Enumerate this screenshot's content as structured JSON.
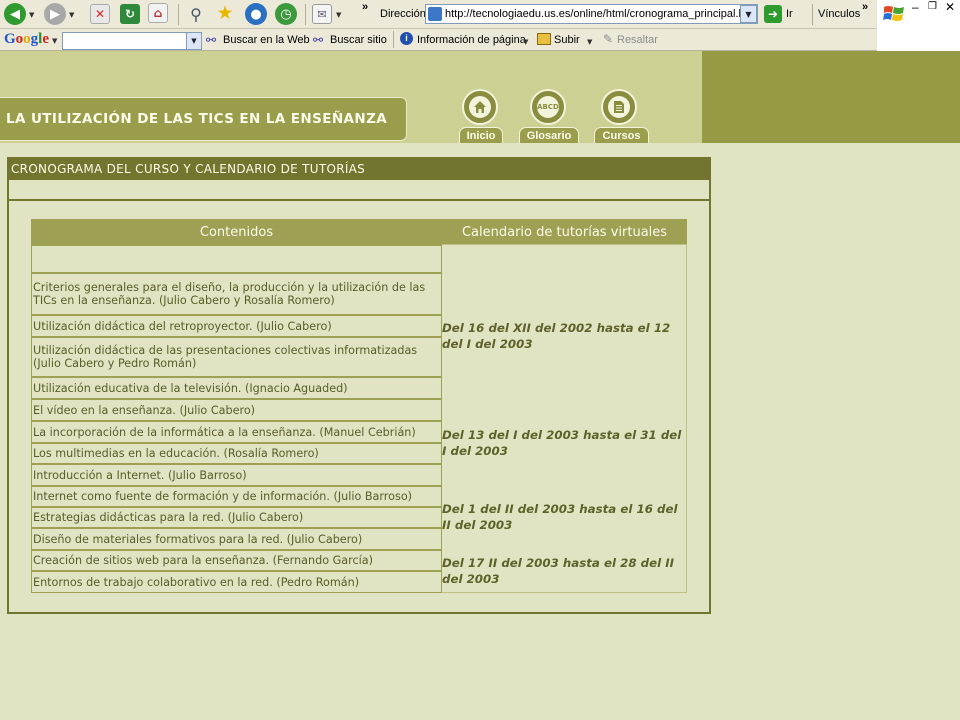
{
  "browser": {
    "address_label": "Dirección",
    "url": "http://tecnologiaedu.us.es/online/html/cronograma_principal.htm",
    "go_label": "Ir",
    "links_label": "Vínculos",
    "google_logo": "Google",
    "search_web_label": "Buscar en la Web",
    "search_site_label": "Buscar sitio",
    "page_info_label": "Información de página",
    "up_label": "Subir",
    "highlight_label": "Resaltar"
  },
  "site": {
    "title": "LA UTILIZACIÓN DE LAS TICS EN LA ENSEÑANZA",
    "nav": [
      {
        "label": "Inicio"
      },
      {
        "label": "Glosario"
      },
      {
        "label": "Cursos"
      }
    ],
    "glossary_icon_text": "ABCD"
  },
  "panel": {
    "heading": "CRONOGRAMA DEL CURSO Y CALENDARIO DE TUTORÍAS"
  },
  "table": {
    "headers": [
      "Contenidos",
      "Calendario de tutorías virtuales"
    ],
    "rows": [
      "",
      "Criterios generales para el diseño, la producción y la utilización de las TICs en la enseñanza. (Julio Cabero y Rosalía Romero)",
      "Utilización didáctica del retroproyector. (Julio Cabero)",
      "Utilización didáctica de las presentaciones colectivas informatizadas (Julio Cabero y Pedro Román)",
      "Utilización educativa de la televisión. (Ignacio Aguaded)",
      "El vídeo en la enseñanza. (Julio Cabero)",
      "La incorporación de la informática a la enseñanza. (Manuel Cebrián)",
      "Los multimedias en la educación. (Rosalía Romero)",
      "Introducción a Internet. (Julio Barroso)",
      "Internet como fuente de formación y de información. (Julio Barroso)",
      "Estrategias didácticas para la red. (Julio Cabero)",
      "Diseño de materiales formativos para la red. (Julio Cabero)",
      "Creación de sitios web para la enseñanza. (Fernando García)",
      "Entornos de trabajo colaborativo en la red. (Pedro Román)"
    ],
    "calendar": [
      "Del 16 del XII del 2002 hasta el 12 del I del 2003",
      "Del 13 del I del 2003 hasta el 31 del I del 2003",
      "Del 1 del II del 2003 hasta el 16 del II del 2003",
      "Del 17 II del 2003 hasta el 28 del II del 2003"
    ]
  }
}
